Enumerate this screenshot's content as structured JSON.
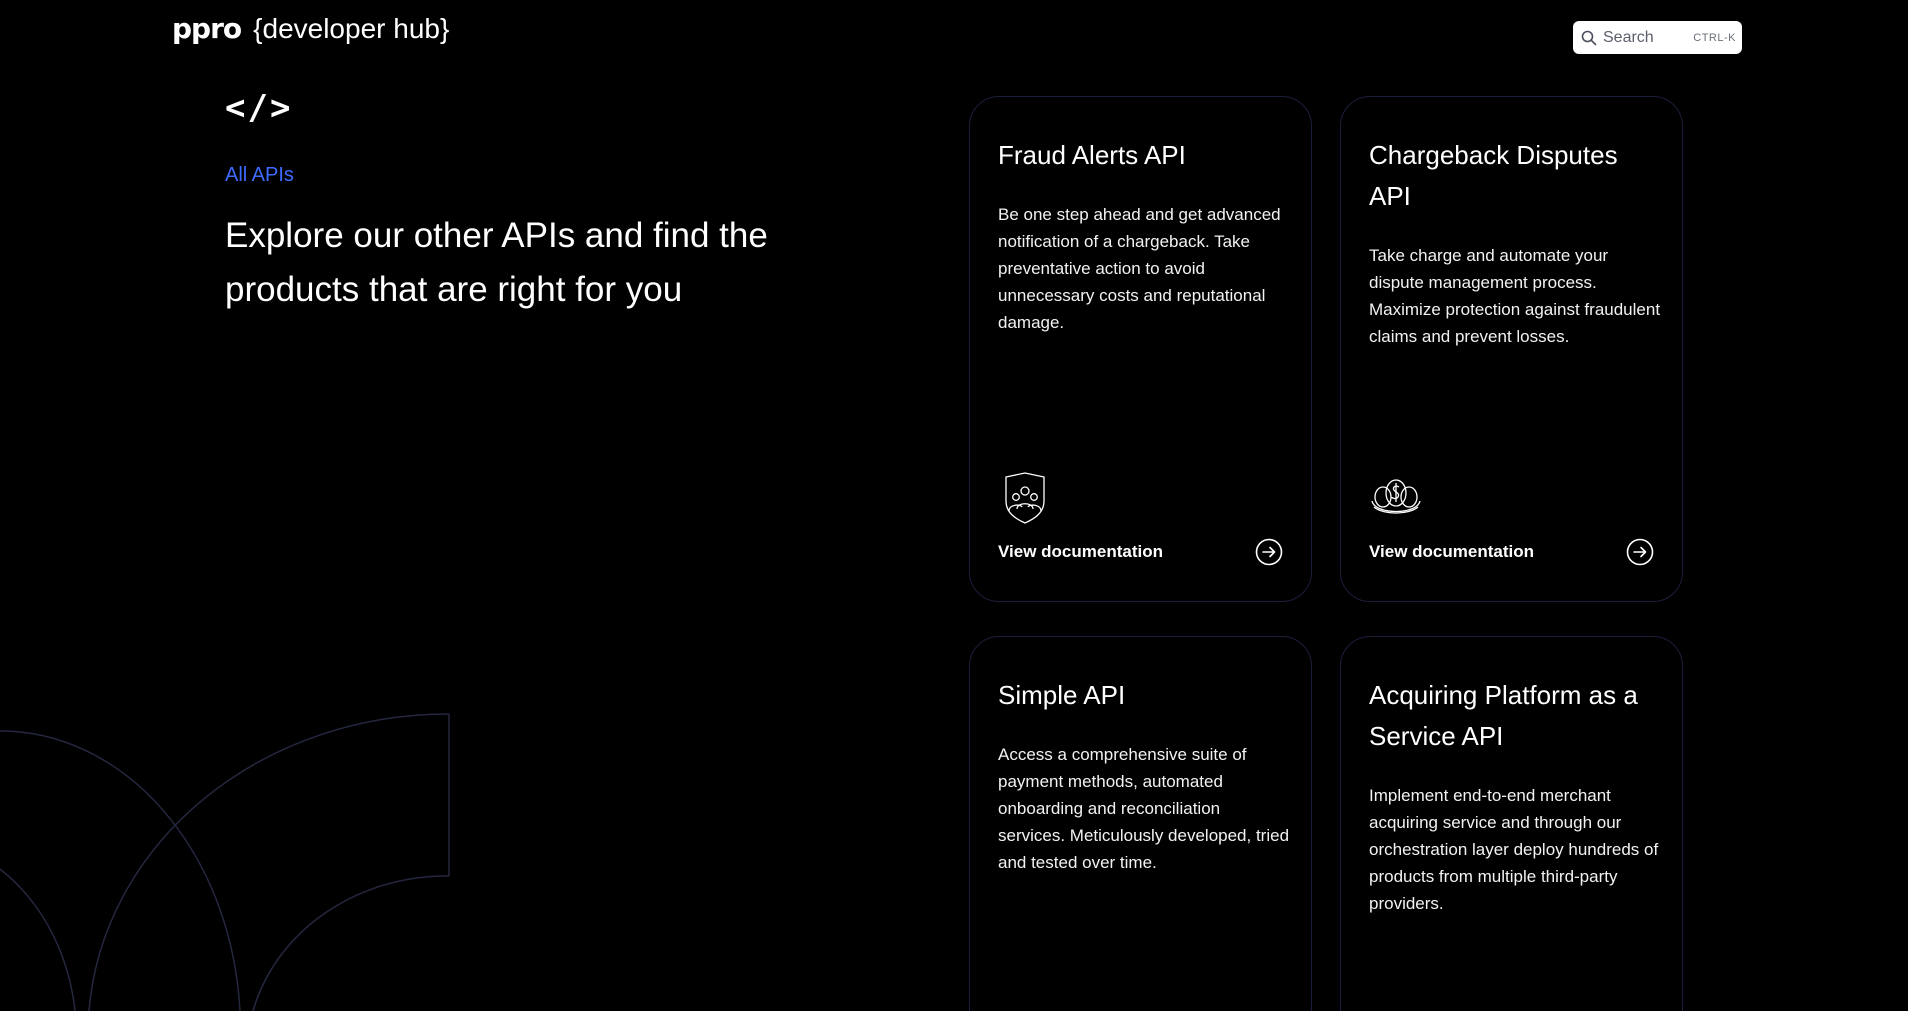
{
  "header": {
    "logo_word": "ppro",
    "logo_hub": "{developer hub}",
    "search": {
      "placeholder": "Search",
      "shortcut": "CTRL-K",
      "icon": "search-icon"
    }
  },
  "hero": {
    "code_symbol": "</>",
    "breadcrumb": "All APIs",
    "headline": "Explore our other APIs and find the products that are right for you"
  },
  "cards": [
    {
      "title": "Fraud Alerts API",
      "description": "Be one step ahead and get advanced notification of a chargeback. Take preventative action to avoid unnecessary costs and reputational damage.",
      "icon": "shield-people-icon",
      "link_label": "View documentation"
    },
    {
      "title": "Chargeback Disputes API",
      "description": "Take charge and automate your dispute management process. Maximize protection against fraudulent claims and prevent losses.",
      "icon": "money-eggs-nest-icon",
      "link_label": "View documentation"
    },
    {
      "title": "Simple API",
      "description": "Access a comprehensive suite of payment methods, automated onboarding and reconciliation services. Meticulously developed, tried and tested over time."
    },
    {
      "title": "Acquiring Platform as a Service API",
      "description": "Implement end-to-end merchant acquiring service and through our orchestration layer deploy hundreds of products from multiple third-party providers."
    }
  ],
  "colors": {
    "background": "#000000",
    "accent": "#3d6bff",
    "card_border": "#1b1e3a",
    "decorative_arc": "#24273f"
  }
}
